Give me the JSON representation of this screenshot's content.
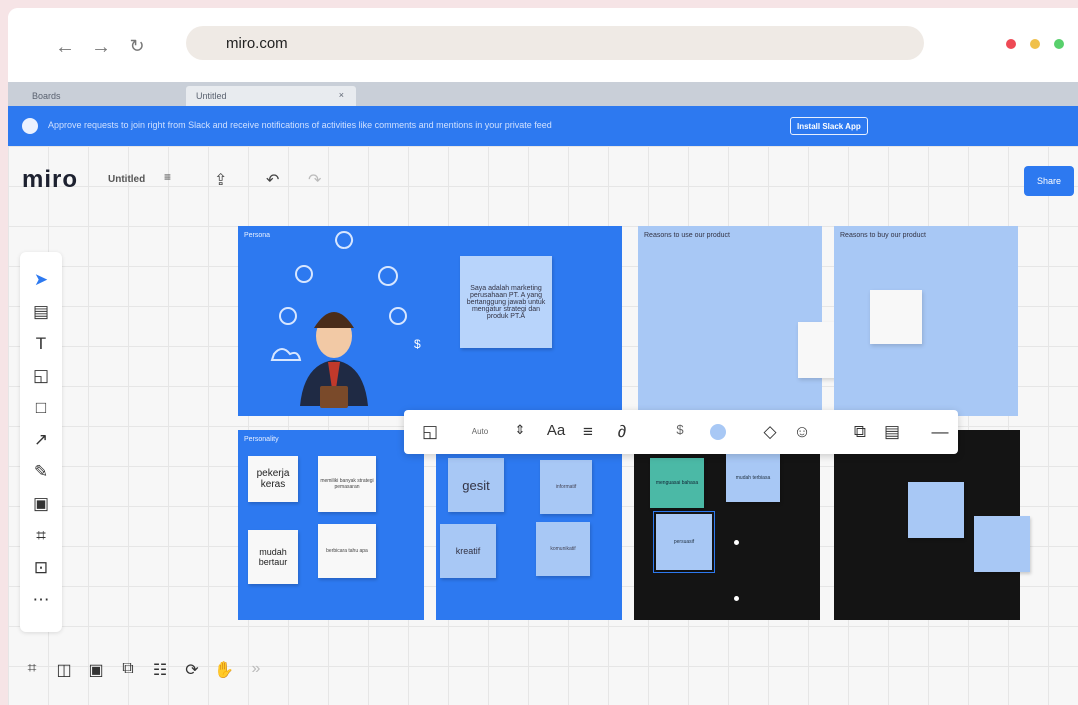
{
  "browser": {
    "url": "miro.com",
    "tabs": [
      {
        "label": "Boards"
      },
      {
        "label": "Untitled"
      }
    ],
    "window_dots": [
      "#ee4a55",
      "#f0c04a",
      "#58d06c"
    ]
  },
  "notification": {
    "message": "Approve requests to join right from Slack and receive notifications of activities like comments and mentions in your private feed",
    "button": "Install Slack App"
  },
  "header": {
    "logo": "miro",
    "board_title": "Untitled",
    "share": "Share"
  },
  "context_toolbar": {
    "font_size": "Auto"
  },
  "frames": {
    "persona": {
      "title": "Persona",
      "text": "Saya adalah marketing perusahaan PT. A yang bertanggung jawab untuk mengatur strategi dan produk PT.A"
    },
    "reasons_use": {
      "title": "Reasons to use our product"
    },
    "reasons_buy": {
      "title": "Reasons to buy our product"
    },
    "personality": {
      "title": "Personality",
      "notes": [
        "pekerja keras",
        "memiliki banyak strategi pemasaran",
        "mudah bertaur",
        "berbicara tahu apa"
      ]
    },
    "traits": {
      "notes": [
        "gesit",
        "kreatif",
        "informatif",
        "komunikatif"
      ]
    },
    "dark": {
      "notes": [
        "menguasai bahasa",
        "mudah terbiasa",
        "persuasif"
      ]
    }
  }
}
